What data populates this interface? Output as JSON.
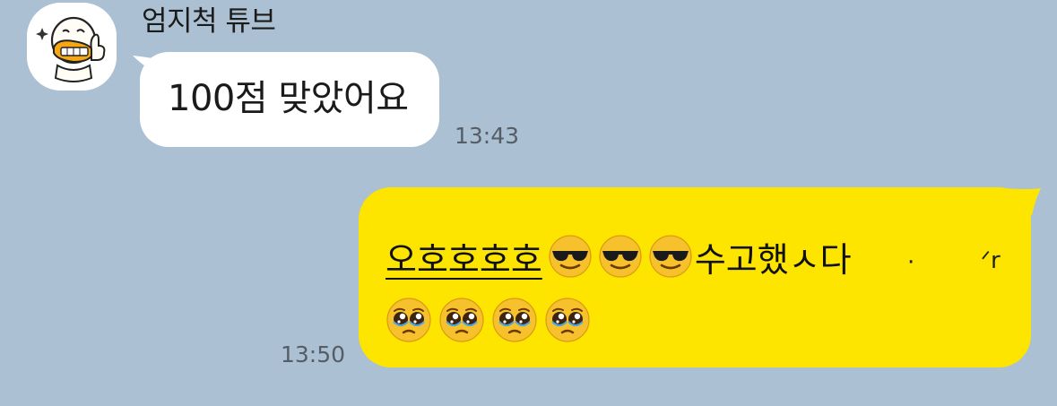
{
  "chat": {
    "sender_name": "엄지척 튜브",
    "incoming_message": {
      "text": "100점 맞았어요",
      "time": "13:43"
    },
    "outgoing_message": {
      "main_text": "오호호호호",
      "emoji_group_1": [
        "smiling-face-with-sunglasses",
        "smiling-face-with-sunglasses",
        "smiling-face-with-sunglasses"
      ],
      "after_text": "수고했ㅅ다",
      "trailing_mark_1": "·",
      "trailing_mark_2": "ᐟr",
      "emoji_group_2": [
        "pleading-face",
        "pleading-face",
        "pleading-face",
        "pleading-face"
      ],
      "time": "13:50"
    }
  },
  "colors": {
    "background": "#abc0d2",
    "incoming_bubble": "#ffffff",
    "outgoing_bubble": "#fde500",
    "timestamp": "#555d66"
  },
  "icons": {
    "avatar": "tube-duck-thumbs-up-avatar"
  }
}
